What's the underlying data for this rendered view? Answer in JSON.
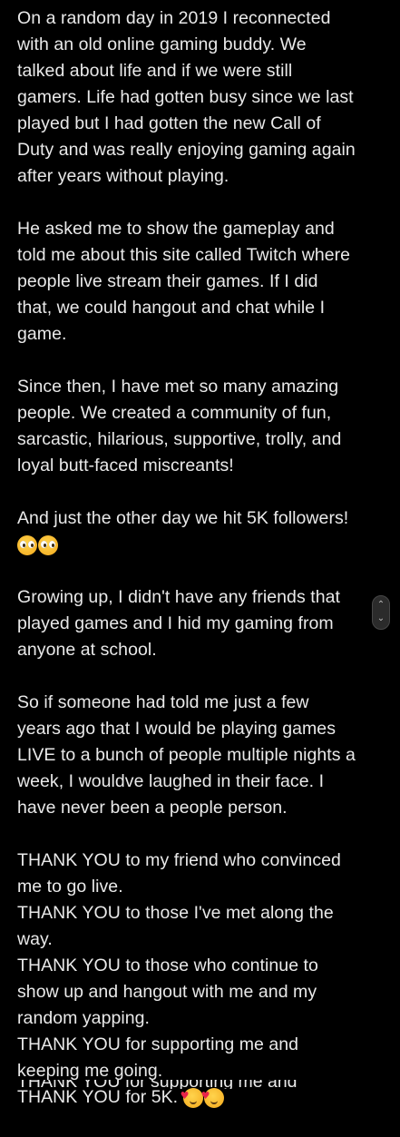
{
  "post": {
    "paragraphs": [
      {
        "lines": [
          "On a random day in 2019 I reconnected",
          "with an old online gaming buddy. We",
          "talked about life and if we were still",
          "gamers. Life had gotten busy since we last",
          "played but I had gotten the new Call of",
          "Duty and was really enjoying gaming again",
          "after years without playing."
        ]
      },
      {
        "lines": [
          "He asked me to show the gameplay and",
          "told me about this site called Twitch where",
          "people live stream their games. If I did",
          "that, we could hangout and chat while I",
          "game."
        ]
      },
      {
        "lines": [
          "Since then, I have met so many amazing",
          "people. We created a community of fun,",
          "sarcastic, hilarious, supportive, trolly, and",
          "loyal butt-faced miscreants!"
        ]
      },
      {
        "lines": [
          "And just the other day we hit 5K followers!"
        ],
        "emoji": [
          "pleading-face",
          "pleading-face"
        ]
      },
      {
        "lines": [
          "Growing up, I didn't have any friends that",
          "played games and I hid my gaming from",
          "anyone at school."
        ]
      },
      {
        "lines": [
          "So if someone had told me just a few",
          "years ago that I would be playing games",
          "LIVE to a bunch of people multiple nights a",
          "week, I wouldve laughed in their face. I",
          "have never been a people person."
        ]
      },
      {
        "lines": [
          "THANK YOU to my friend who convinced",
          "me to go live.",
          "THANK YOU to those I've met along the",
          "way.",
          "THANK YOU to those who continue to",
          "show up and hangout with me and my",
          "random yapping.",
          "THANK YOU for supporting me and",
          "keeping me going.",
          "THANK YOU for 5K."
        ],
        "trailing_emoji": [
          "smiling-face-with-hearts",
          "smiling-face-with-hearts"
        ]
      }
    ],
    "cutoff_line": "THANK YOU for supporting me and"
  },
  "scroll_handle": {
    "up_icon": "chevron-up-icon",
    "down_icon": "chevron-down-icon"
  },
  "colors": {
    "background": "#000000",
    "text": "#e9e9e9"
  }
}
